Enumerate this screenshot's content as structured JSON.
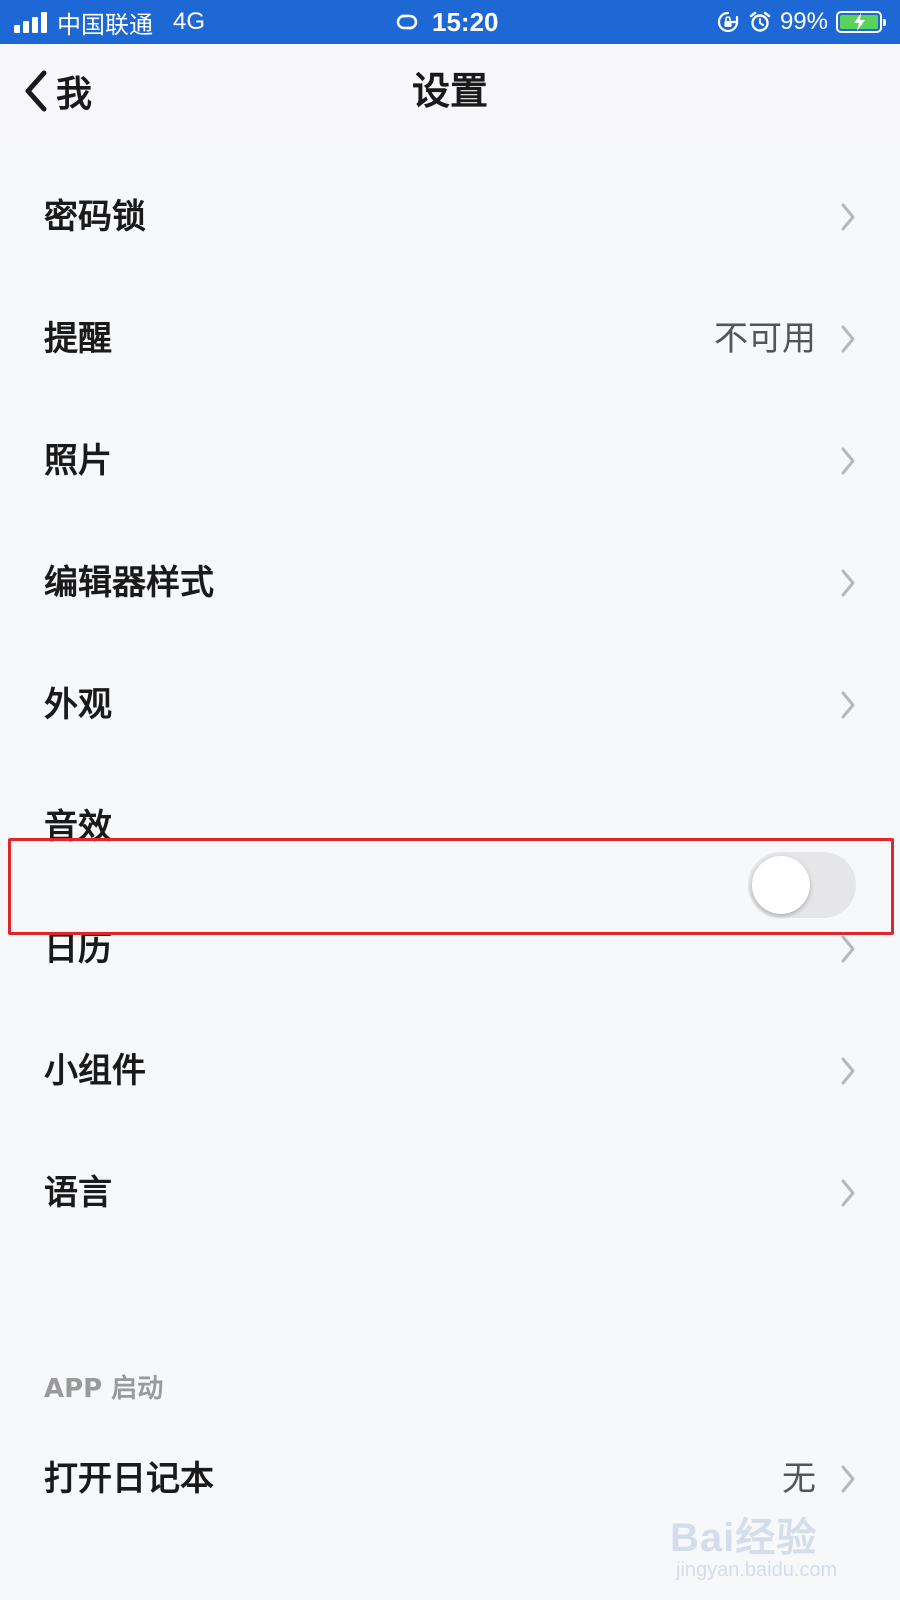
{
  "status_bar": {
    "carrier": "中国联通",
    "network": "4G",
    "time": "15:20",
    "battery_percent": "99%",
    "battery_level": 0.99,
    "icons": [
      "signal-icon",
      "hotspot-link-icon",
      "rotation-lock-icon",
      "alarm-icon",
      "battery-charging-icon"
    ],
    "battery_fill_color": "#5ad35c",
    "background_color": "#1d68d4"
  },
  "nav": {
    "back_label": "我",
    "title": "设置"
  },
  "settings": {
    "items": [
      {
        "label": "密码锁",
        "value": "",
        "control": "chevron"
      },
      {
        "label": "提醒",
        "value": "不可用",
        "control": "chevron"
      },
      {
        "label": "照片",
        "value": "",
        "control": "chevron"
      },
      {
        "label": "编辑器样式",
        "value": "",
        "control": "chevron"
      },
      {
        "label": "外观",
        "value": "",
        "control": "chevron"
      },
      {
        "label": "音效",
        "value": "",
        "control": "toggle",
        "toggle_on": false
      },
      {
        "label": "日历",
        "value": "",
        "control": "chevron"
      },
      {
        "label": "小组件",
        "value": "",
        "control": "chevron"
      },
      {
        "label": "语言",
        "value": "",
        "control": "chevron"
      }
    ]
  },
  "startup_section": {
    "header": "APP 启动",
    "item": {
      "label": "打开日记本",
      "value": "无",
      "control": "chevron"
    }
  },
  "highlight_color": "#e0262b",
  "watermark": {
    "brand": "Bai经验",
    "url": "jingyan.baidu.com"
  }
}
